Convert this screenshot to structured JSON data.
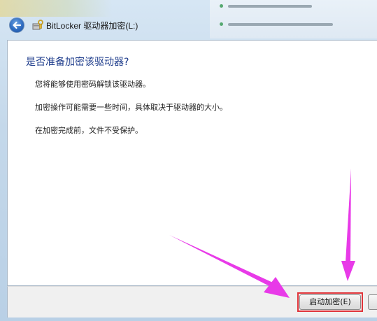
{
  "window": {
    "title": "BitLocker 驱动器加密(L:)"
  },
  "content": {
    "heading": "是否准备加密该驱动器?",
    "paragraphs": [
      "您将能够使用密码解锁该驱动器。",
      "加密操作可能需要一些时间，具体取决于驱动器的大小。",
      "在加密完成前，文件不受保护。"
    ]
  },
  "footer": {
    "start_button_label": "启动加密(E)"
  },
  "colors": {
    "heading": "#1f3d8c",
    "highlight_box": "#e0343a",
    "annotation_arrow": "#e83ae8"
  }
}
